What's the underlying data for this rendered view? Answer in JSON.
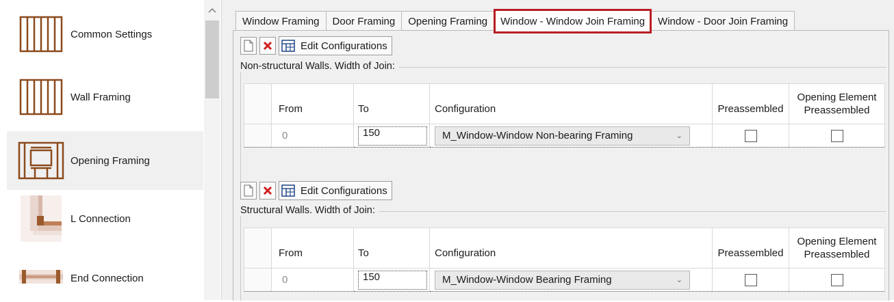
{
  "sidebar": {
    "items": [
      {
        "label": "Common Settings",
        "icon": "wall-frame-icon"
      },
      {
        "label": "Wall Framing",
        "icon": "wall-frame-icon"
      },
      {
        "label": "Opening Framing",
        "icon": "opening-frame-icon"
      },
      {
        "label": "L Connection",
        "icon": "l-connection-icon"
      },
      {
        "label": "End Connection",
        "icon": "end-connection-icon"
      }
    ],
    "selected_index": 2
  },
  "tabs": [
    {
      "label": "Window Framing"
    },
    {
      "label": "Door Framing"
    },
    {
      "label": "Opening Framing"
    },
    {
      "label": "Window - Window Join Framing",
      "active": true
    },
    {
      "label": "Window - Door Join Framing"
    }
  ],
  "toolbar": {
    "edit_label": "Edit Configurations"
  },
  "table_headers": {
    "from": "From",
    "to": "To",
    "configuration": "Configuration",
    "preassembled": "Preassembled",
    "opening_line1": "Opening Element",
    "opening_line2": "Preassembled"
  },
  "groups": [
    {
      "title": "Non-structural Walls. Width of Join:",
      "rows": [
        {
          "from": "0",
          "to": "150",
          "configuration": "M_Window-Window Non-bearing Framing",
          "preassembled": false,
          "opening_preassembled": false
        }
      ]
    },
    {
      "title": "Structural Walls. Width of Join:",
      "rows": [
        {
          "from": "0",
          "to": "150",
          "configuration": "M_Window-Window Bearing Framing",
          "preassembled": false,
          "opening_preassembled": false
        }
      ]
    }
  ],
  "colors": {
    "active_tab_border": "#b81d22",
    "wood": "#8b4a1c",
    "delete": "#d11d1d"
  }
}
